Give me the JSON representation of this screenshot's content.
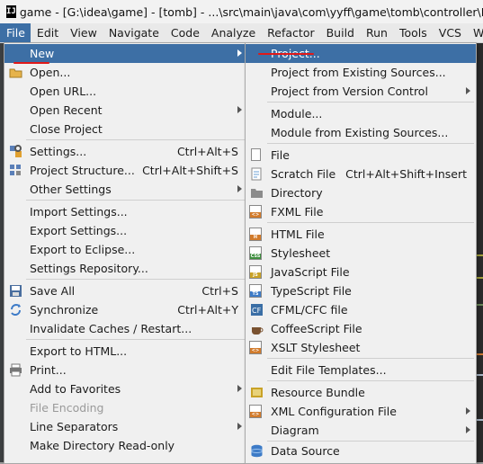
{
  "window": {
    "title": "game - [G:\\idea\\game] - [tomb] - ...\\src\\main\\java\\com\\yyff\\game\\tomb\\controller\\LeaveMess"
  },
  "menubar": [
    "File",
    "Edit",
    "View",
    "Navigate",
    "Code",
    "Analyze",
    "Refactor",
    "Build",
    "Run",
    "Tools",
    "VCS",
    "Windo"
  ],
  "file_menu": {
    "items": [
      {
        "label": "New",
        "arrow": true
      },
      {
        "label": "Open..."
      },
      {
        "label": "Open URL..."
      },
      {
        "label": "Open Recent",
        "arrow": true
      },
      {
        "label": "Close Project"
      },
      {
        "label": "Settings...",
        "shortcut": "Ctrl+Alt+S"
      },
      {
        "label": "Project Structure...",
        "shortcut": "Ctrl+Alt+Shift+S"
      },
      {
        "label": "Other Settings",
        "arrow": true
      },
      {
        "label": "Import Settings..."
      },
      {
        "label": "Export Settings..."
      },
      {
        "label": "Export to Eclipse..."
      },
      {
        "label": "Settings Repository..."
      },
      {
        "label": "Save All",
        "shortcut": "Ctrl+S"
      },
      {
        "label": "Synchronize",
        "shortcut": "Ctrl+Alt+Y"
      },
      {
        "label": "Invalidate Caches / Restart..."
      },
      {
        "label": "Export to HTML..."
      },
      {
        "label": "Print..."
      },
      {
        "label": "Add to Favorites",
        "arrow": true
      },
      {
        "label": "File Encoding"
      },
      {
        "label": "Line Separators",
        "arrow": true
      },
      {
        "label": "Make Directory Read-only"
      }
    ]
  },
  "new_submenu": {
    "items": [
      {
        "label": "Project..."
      },
      {
        "label": "Project from Existing Sources..."
      },
      {
        "label": "Project from Version Control",
        "arrow": true
      },
      {
        "label": "Module..."
      },
      {
        "label": "Module from Existing Sources..."
      },
      {
        "label": "File"
      },
      {
        "label": "Scratch File",
        "shortcut": "Ctrl+Alt+Shift+Insert"
      },
      {
        "label": "Directory"
      },
      {
        "label": "FXML File"
      },
      {
        "label": "HTML File"
      },
      {
        "label": "Stylesheet"
      },
      {
        "label": "JavaScript File"
      },
      {
        "label": "TypeScript File"
      },
      {
        "label": "CFML/CFC file"
      },
      {
        "label": "CoffeeScript File"
      },
      {
        "label": "XSLT Stylesheet"
      },
      {
        "label": "Edit File Templates..."
      },
      {
        "label": "Resource Bundle"
      },
      {
        "label": "XML Configuration File",
        "arrow": true
      },
      {
        "label": "Diagram",
        "arrow": true
      },
      {
        "label": "Data Source"
      }
    ]
  },
  "colors": {
    "selection": "#3d6fa5",
    "annotation": "#e01919"
  }
}
